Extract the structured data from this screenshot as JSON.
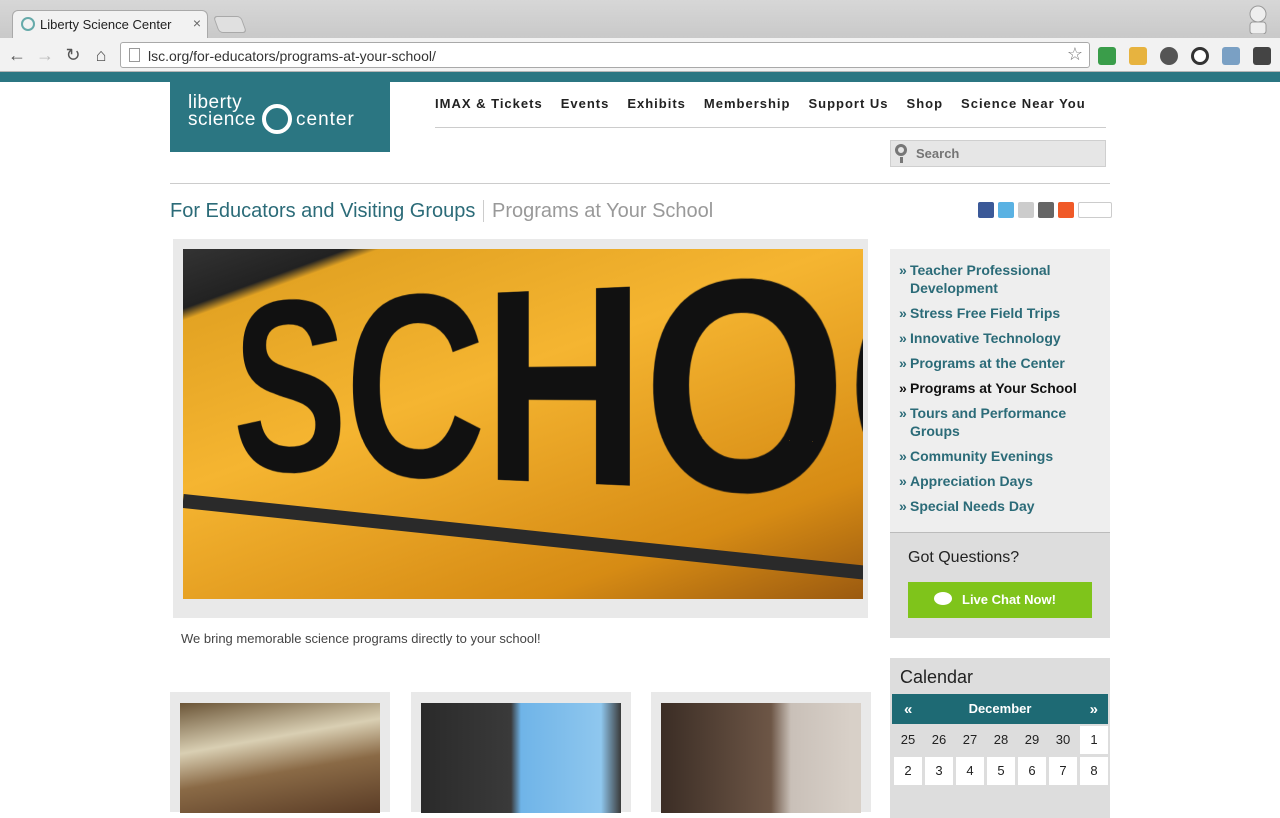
{
  "browser": {
    "tab_title": "Liberty Science Center",
    "tab_close": "×",
    "url": "lsc.org/for-educators/programs-at-your-school/"
  },
  "logo": {
    "line1": "liberty",
    "line2": "science",
    "line3": "center"
  },
  "nav": [
    "IMAX & Tickets",
    "Events",
    "Exhibits",
    "Membership",
    "Support Us",
    "Shop",
    "Science Near You"
  ],
  "search": {
    "placeholder": "Search"
  },
  "breadcrumb": {
    "main": "For Educators and Visiting Groups",
    "sub": "Programs at Your School"
  },
  "hero": {
    "word": "SCHOOL",
    "caption": "We bring memorable science programs directly to your school!"
  },
  "sidebar": {
    "items": [
      {
        "label": "Teacher Professional Development"
      },
      {
        "label": "Stress Free Field Trips"
      },
      {
        "label": "Innovative Technology"
      },
      {
        "label": "Programs at the Center"
      },
      {
        "label": "Programs at Your School",
        "active": true
      },
      {
        "label": "Tours and Performance Groups"
      },
      {
        "label": "Community Evenings"
      },
      {
        "label": "Appreciation Days"
      },
      {
        "label": "Special Needs Day"
      }
    ],
    "bullet": "»"
  },
  "questions": {
    "title": "Got Questions?",
    "button": "Live Chat Now!"
  },
  "calendar": {
    "title": "Calendar",
    "prev": "«",
    "next": "»",
    "month": "December",
    "row1": [
      "25",
      "26",
      "27",
      "28",
      "29",
      "30",
      "1"
    ],
    "row2": [
      "2",
      "3",
      "4",
      "5",
      "6",
      "7",
      "8"
    ]
  }
}
